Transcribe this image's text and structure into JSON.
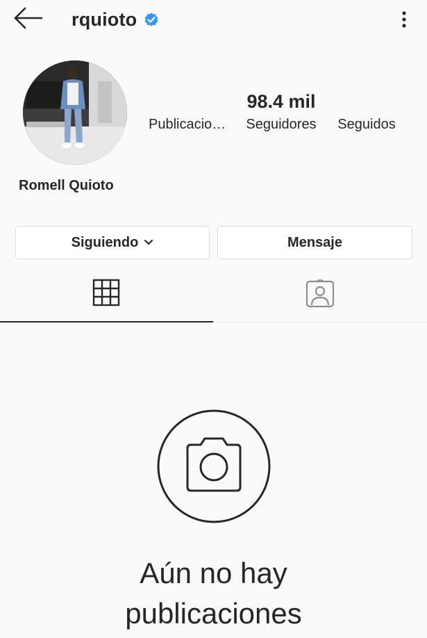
{
  "header": {
    "back_icon": "arrow-left-icon",
    "username": "rquioto",
    "verified_icon": "verified-badge-icon",
    "more_icon": "more-vertical-icon"
  },
  "profile": {
    "full_name": "Romell Quioto",
    "stats": [
      {
        "value": "",
        "label": "Publicaciones"
      },
      {
        "value": "98.4 mil",
        "label": "Seguidores"
      },
      {
        "value": "",
        "label": "Seguidos"
      }
    ]
  },
  "actions": {
    "follow_label": "Siguiendo",
    "message_label": "Mensaje"
  },
  "tabs": {
    "grid_icon": "grid-icon",
    "tagged_icon": "tagged-person-icon"
  },
  "empty_state": {
    "icon": "camera-icon",
    "line1": "Aún no hay",
    "line2": "publicaciones"
  },
  "colors": {
    "background": "#fafafa",
    "verified_blue": "#3897f0",
    "text": "#262626",
    "border": "#dbdbdb"
  }
}
